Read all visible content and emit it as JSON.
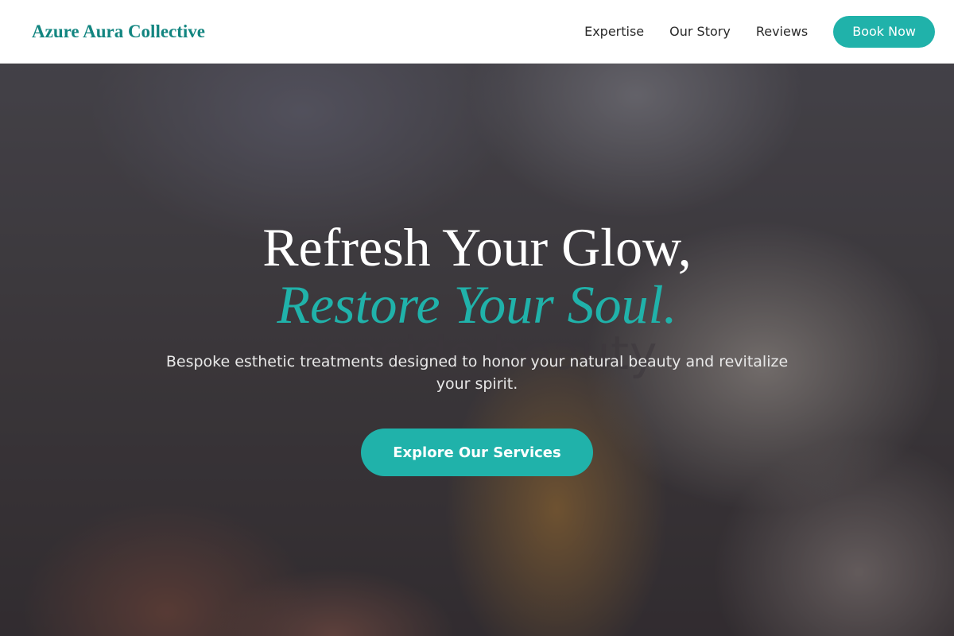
{
  "header": {
    "brand": "Azure Aura Collective",
    "nav": [
      "Expertise",
      "Our Story",
      "Reviews"
    ],
    "cta_label": "Book Now"
  },
  "hero": {
    "headline_line1": "Refresh Your Glow,",
    "headline_line2": "Restore Your Soul.",
    "watermark": "seaside beauty",
    "subtitle": "Bespoke esthetic treatments designed to honor your natural beauty and revitalize your spirit.",
    "cta_label": "Explore Our Services"
  },
  "colors": {
    "accent": "#20b2aa",
    "brand": "#128580"
  }
}
